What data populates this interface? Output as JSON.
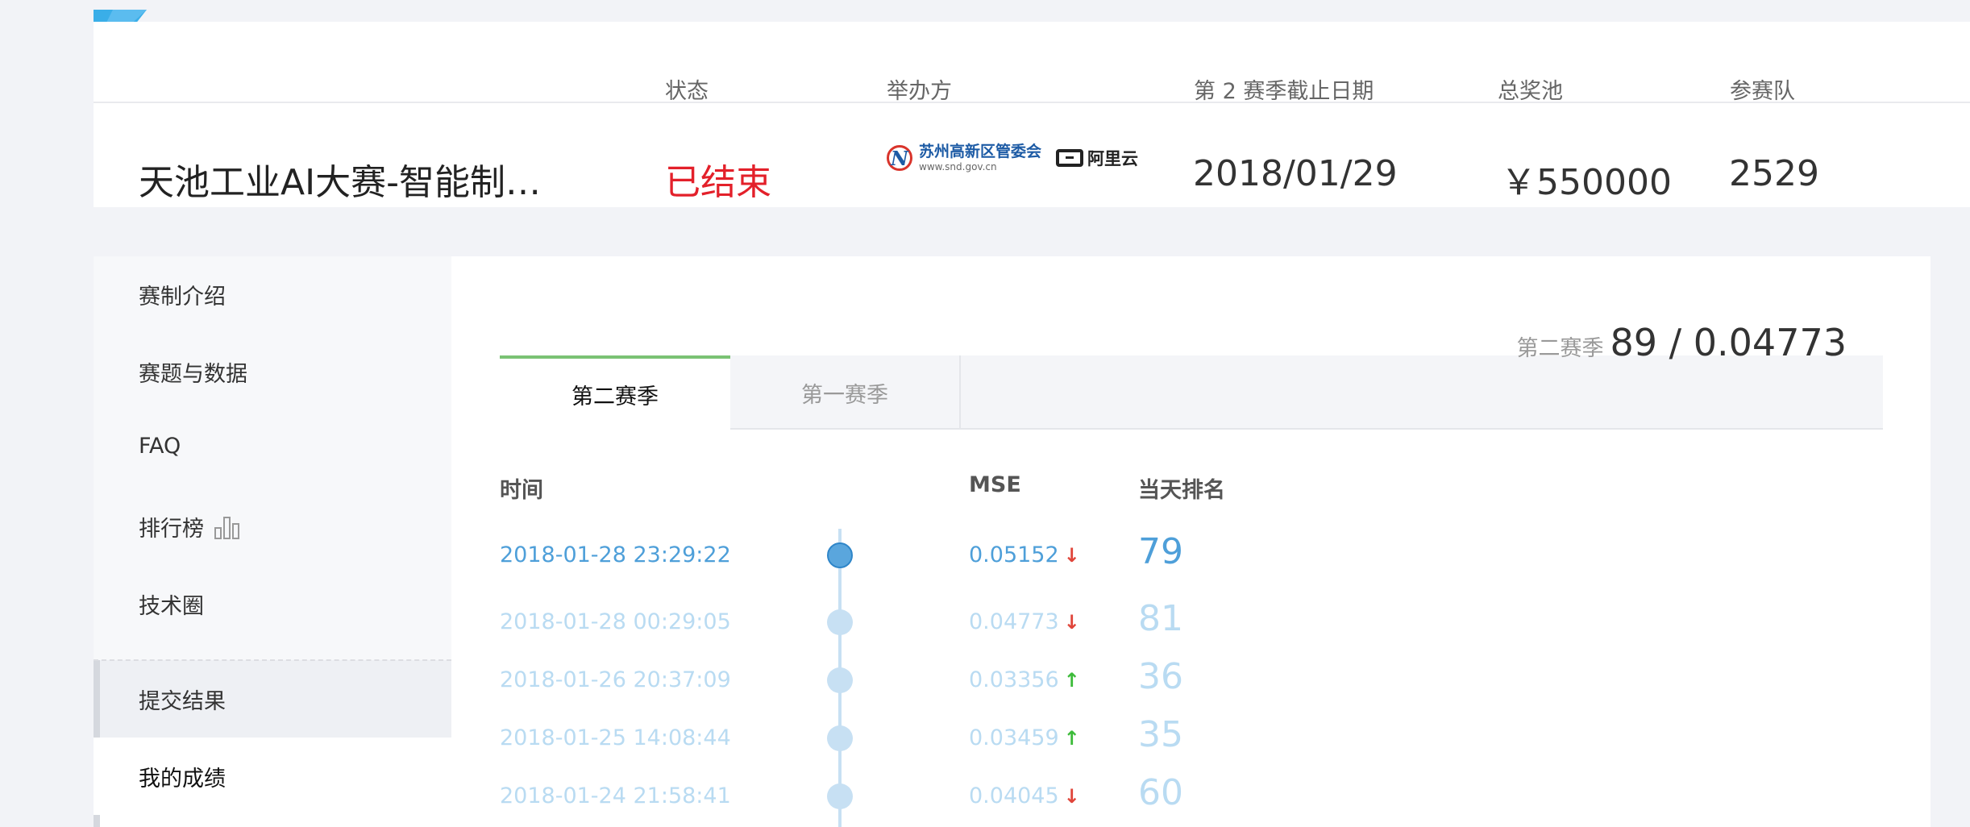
{
  "header": {
    "labels": {
      "status": "状态",
      "organizer": "举办方",
      "deadline": "第 2 赛季截止日期",
      "prize": "总奖池",
      "teams": "参赛队"
    },
    "competition_title": "天池工业AI大赛-智能制…",
    "status": "已结束",
    "organizers": {
      "snd_name": "苏州高新区管委会",
      "snd_url": "www.snd.gov.cn",
      "aliyun": "阿里云"
    },
    "deadline": "2018/01/29",
    "prize": "￥550000",
    "teams": "2529"
  },
  "sidebar": {
    "items": [
      {
        "label": "赛制介绍"
      },
      {
        "label": "赛题与数据"
      },
      {
        "label": "FAQ"
      },
      {
        "label": "排行榜"
      },
      {
        "label": "技术圈"
      },
      {
        "label": "提交结果"
      },
      {
        "label": "我的成绩"
      }
    ]
  },
  "main": {
    "tabs": [
      {
        "label": "第二赛季",
        "active": true
      },
      {
        "label": "第一赛季",
        "active": false
      }
    ],
    "season_label": "第二赛季",
    "season_score": "89 / 0.04773",
    "columns": {
      "time": "时间",
      "mse": "MSE",
      "rank": "当天排名"
    },
    "rows": [
      {
        "time": "2018-01-28 23:29:22",
        "mse": "0.05152",
        "trend": "down",
        "rank": "79"
      },
      {
        "time": "2018-01-28 00:29:05",
        "mse": "0.04773",
        "trend": "down",
        "rank": "81"
      },
      {
        "time": "2018-01-26 20:37:09",
        "mse": "0.03356",
        "trend": "up",
        "rank": "36"
      },
      {
        "time": "2018-01-25 14:08:44",
        "mse": "0.03459",
        "trend": "up",
        "rank": "35"
      },
      {
        "time": "2018-01-24 21:58:41",
        "mse": "0.04045",
        "trend": "down",
        "rank": "60"
      }
    ]
  },
  "colors": {
    "status_ended": "#e3202a",
    "tab_active_accent": "#7ac274",
    "row_highlight": "#4e9fd9",
    "row_faded": "#b9dbf2",
    "trend_down": "#e0453a",
    "trend_up": "#3dbb3a"
  }
}
